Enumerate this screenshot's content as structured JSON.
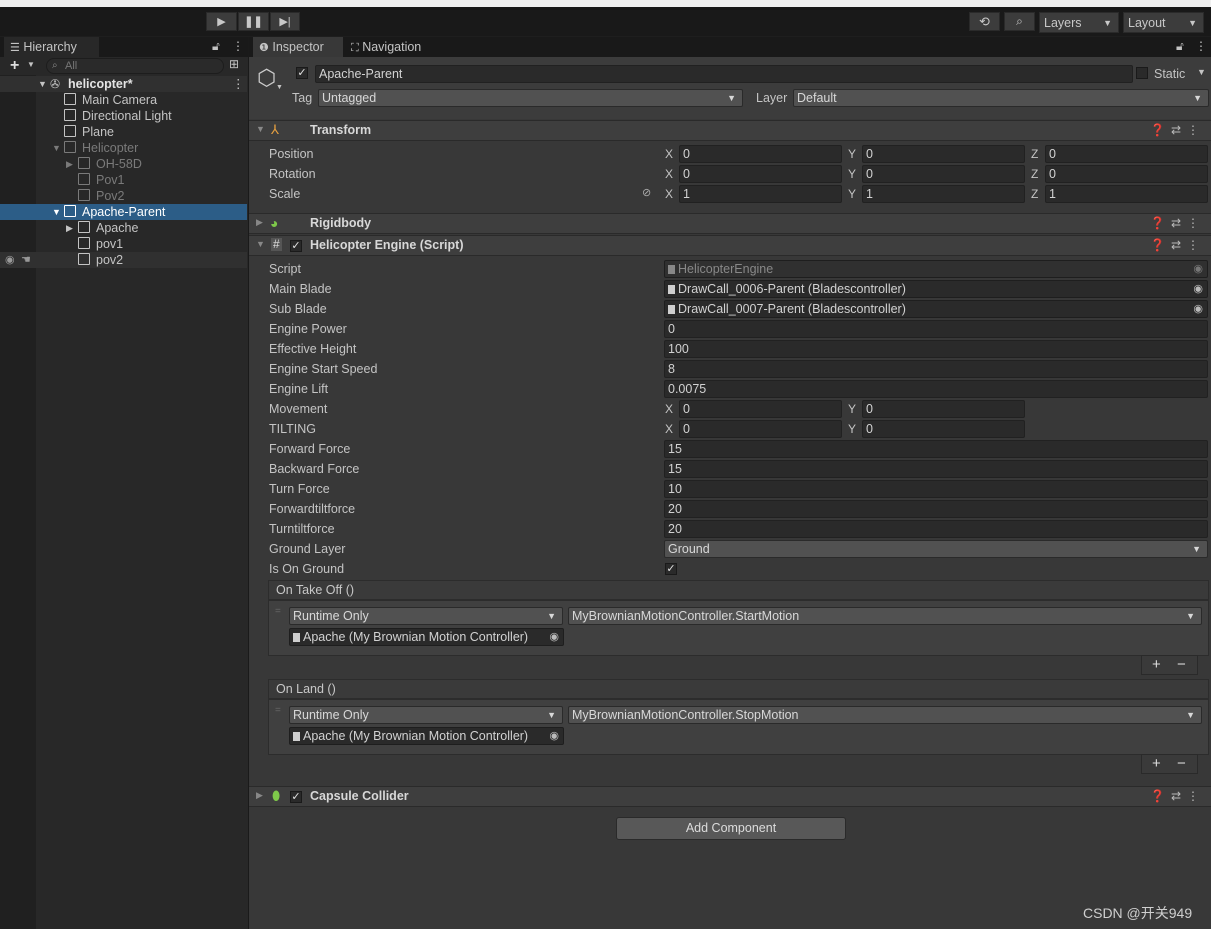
{
  "toolbar": {
    "play_icon": "play-icon",
    "pause_icon": "pause-icon",
    "step_icon": "step-icon",
    "layers_label": "Layers",
    "layout_label": "Layout"
  },
  "hierarchy": {
    "tab_label": "Hierarchy",
    "search_placeholder": "All",
    "scene_name": "helicopter*",
    "items": [
      {
        "label": "Main Camera"
      },
      {
        "label": "Directional Light"
      },
      {
        "label": "Plane"
      },
      {
        "label": "Helicopter"
      },
      {
        "label": "OH-58D"
      },
      {
        "label": "Pov1"
      },
      {
        "label": "Pov2"
      },
      {
        "label": "Apache-Parent"
      },
      {
        "label": "Apache"
      },
      {
        "label": "pov1"
      },
      {
        "label": "pov2"
      }
    ]
  },
  "inspector": {
    "tab_inspector": "Inspector",
    "tab_navigation": "Navigation",
    "object_name": "Apache-Parent",
    "static_label": "Static",
    "tag_label": "Tag",
    "tag_value": "Untagged",
    "layer_label": "Layer",
    "layer_value": "Default",
    "transform": {
      "title": "Transform",
      "position_label": "Position",
      "rotation_label": "Rotation",
      "scale_label": "Scale",
      "axis_x": "X",
      "axis_y": "Y",
      "axis_z": "Z",
      "position": [
        "0",
        "0",
        "0"
      ],
      "rotation": [
        "0",
        "0",
        "0"
      ],
      "scale": [
        "1",
        "1",
        "1"
      ]
    },
    "rigidbody": {
      "title": "Rigidbody"
    },
    "engine": {
      "title": "Helicopter Engine (Script)",
      "script_label": "Script",
      "script_value": "HelicopterEngine",
      "main_blade_label": "Main Blade",
      "main_blade_value": "DrawCall_0006-Parent (Bladescontroller)",
      "sub_blade_label": "Sub Blade",
      "sub_blade_value": "DrawCall_0007-Parent (Bladescontroller)",
      "engine_power_label": "Engine Power",
      "engine_power": "0",
      "effective_height_label": "Effective Height",
      "effective_height": "100",
      "engine_start_speed_label": "Engine Start Speed",
      "engine_start_speed": "8",
      "engine_lift_label": "Engine Lift",
      "engine_lift": "0.0075",
      "movement_label": "Movement",
      "movement": [
        "0",
        "0"
      ],
      "tilting_label": "TILTING",
      "tilting": [
        "0",
        "0"
      ],
      "forward_force_label": "Forward Force",
      "forward_force": "15",
      "backward_force_label": "Backward Force",
      "backward_force": "15",
      "turn_force_label": "Turn Force",
      "turn_force": "10",
      "forwardtiltforce_label": "Forwardtiltforce",
      "forwardtiltforce": "20",
      "turntiltforce_label": "Turntiltforce",
      "turntiltforce": "20",
      "ground_layer_label": "Ground Layer",
      "ground_layer": "Ground",
      "is_on_ground_label": "Is On Ground",
      "is_on_ground": true,
      "on_take_off": {
        "header": "On Take Off ()",
        "mode": "Runtime Only",
        "function": "MyBrownianMotionController.StartMotion",
        "target": "Apache (My Brownian Motion Controller)"
      },
      "on_land": {
        "header": "On Land ()",
        "mode": "Runtime Only",
        "function": "MyBrownianMotionController.StopMotion",
        "target": "Apache (My Brownian Motion Controller)"
      }
    },
    "capsule_collider": {
      "title": "Capsule Collider"
    },
    "add_component_label": "Add Component"
  },
  "watermark": "CSDN @开关949"
}
